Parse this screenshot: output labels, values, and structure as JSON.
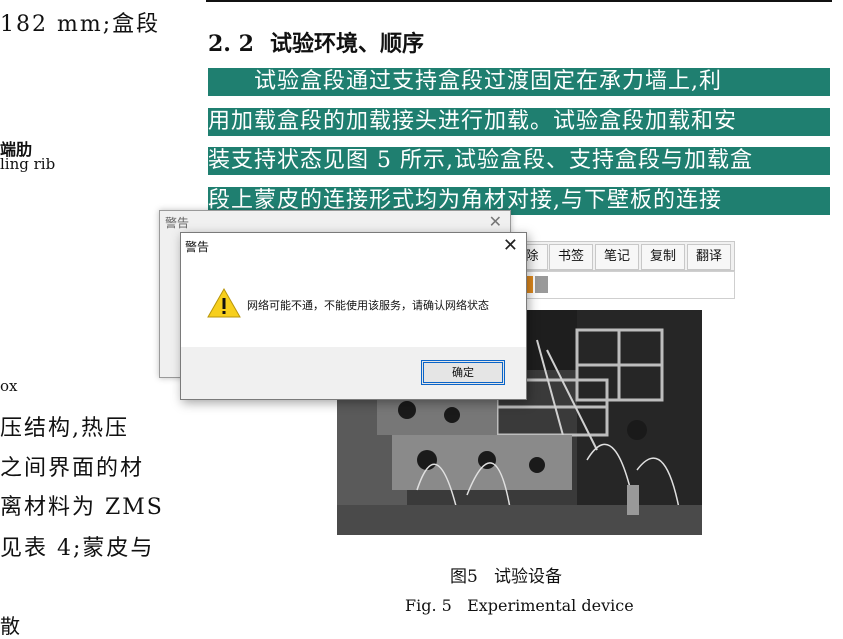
{
  "left_column": {
    "line1": "182 mm;盒段",
    "rib_label_cn": "端肋",
    "rib_label_en": "ling rib",
    "box_fragment": "ox",
    "body_lines": [
      "压结构,热压",
      "之间界面的材",
      "离材料为 ZMS",
      "见表 4;蒙皮与"
    ],
    "bottom_fragment": "散"
  },
  "section": {
    "number": "2. 2",
    "title": "试验环境、顺序",
    "highlighted_lines": [
      "　　试验盒段通过支持盒段过渡固定在承力墙上,利",
      "用加载盒段的加载接头进行加载。试验盒段加载和安",
      "装支持状态见图 5 所示,试验盒段、支持盒段与加载盒",
      "段上蒙皮的连接形式均为角材对接,与下壁板的连接"
    ]
  },
  "toolbar": {
    "buttons": [
      "除",
      "书签",
      "笔记",
      "复制",
      "翻译"
    ]
  },
  "color_swatches": [
    "#e08a1e",
    "#9a9a9a"
  ],
  "figure": {
    "caption_cn_num": "图5",
    "caption_cn": "试验设备",
    "caption_en_num": "Fig. 5",
    "caption_en": "Experimental device"
  },
  "dialog_back": {
    "title": "警告",
    "close": "✕"
  },
  "dialog": {
    "title": "警告",
    "close": "✕",
    "message": "网络可能不通，不能使用该服务，请确认网络状态",
    "ok_label": "确定",
    "icon": "warning-icon"
  }
}
